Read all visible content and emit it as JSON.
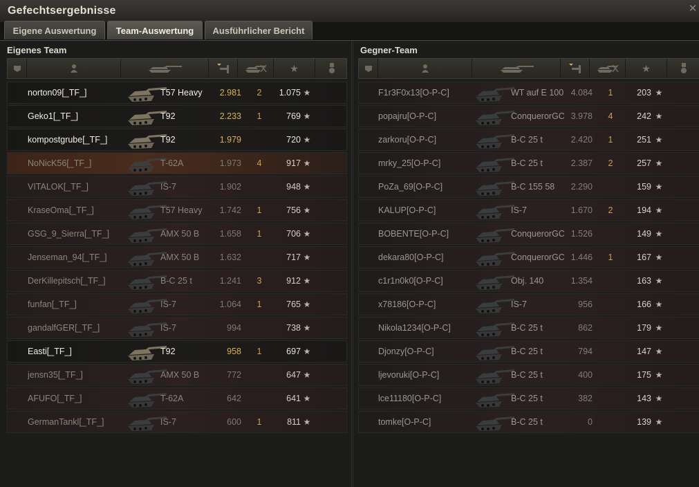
{
  "window": {
    "title": "Gefechtsergebnisse"
  },
  "tabs": [
    {
      "label": "Eigene Auswertung",
      "active": false
    },
    {
      "label": "Team-Auswertung",
      "active": true
    },
    {
      "label": "Ausführlicher Bericht",
      "active": false
    }
  ],
  "own_team": {
    "title": "Eigenes Team",
    "headers": [
      "squad-icon",
      "player-icon",
      "tank-icon",
      "experience-sort-icon",
      "kills-icon",
      "star-icon",
      "medal-icon"
    ],
    "players": [
      {
        "name": "norton09[_TF_]",
        "tank": "T57 Heavy",
        "xp": "2.981",
        "kills": "2",
        "score": "1.075"
      },
      {
        "name": "Geko1[_TF_]",
        "tank": "T92",
        "xp": "2.233",
        "kills": "1",
        "score": "769"
      },
      {
        "name": "kompostgrube[_TF_]",
        "tank": "T92",
        "xp": "1.979",
        "kills": "",
        "score": "720"
      },
      {
        "name": "NoNicK56[_TF_]",
        "tank": "T-62A",
        "xp": "1.973",
        "kills": "4",
        "score": "917"
      },
      {
        "name": "VITALOK[_TF_]",
        "tank": "IS-7",
        "xp": "1.902",
        "kills": "",
        "score": "948"
      },
      {
        "name": "KraseOma[_TF_]",
        "tank": "T57 Heavy",
        "xp": "1.742",
        "kills": "1",
        "score": "756"
      },
      {
        "name": "GSG_9_Sierra[_TF_]",
        "tank": "AMX 50 B",
        "xp": "1.658",
        "kills": "1",
        "score": "706"
      },
      {
        "name": "Jenseman_94[_TF_]",
        "tank": "AMX 50 B",
        "xp": "1.632",
        "kills": "",
        "score": "717"
      },
      {
        "name": "DerKillepitsch[_TF_]",
        "tank": "B-C 25 t",
        "xp": "1.241",
        "kills": "3",
        "score": "912"
      },
      {
        "name": "funfan[_TF_]",
        "tank": "IS-7",
        "xp": "1.064",
        "kills": "1",
        "score": "765"
      },
      {
        "name": "gandalfGER[_TF_]",
        "tank": "IS-7",
        "xp": "994",
        "kills": "",
        "score": "738"
      },
      {
        "name": "Easti[_TF_]",
        "tank": "T92",
        "xp": "958",
        "kills": "1",
        "score": "697"
      },
      {
        "name": "jensn35[_TF_]",
        "tank": "AMX 50 B",
        "xp": "772",
        "kills": "",
        "score": "647"
      },
      {
        "name": "AFUFO[_TF_]",
        "tank": "T-62A",
        "xp": "642",
        "kills": "",
        "score": "641"
      },
      {
        "name": "GermanTankl[_TF_]",
        "tank": "IS-7",
        "xp": "600",
        "kills": "1",
        "score": "811"
      }
    ]
  },
  "enemy_team": {
    "title": "Gegner-Team",
    "headers": [
      "squad-icon",
      "player-icon",
      "tank-icon",
      "experience-sort-icon",
      "kills-icon",
      "star-icon",
      "medal-icon"
    ],
    "players": [
      {
        "name": "F1r3F0x13[O-P-C]",
        "tank": "WT auf E 100",
        "xp": "4.084",
        "kills": "1",
        "score": "203"
      },
      {
        "name": "popajru[O-P-C]",
        "tank": "ConquerorGC",
        "xp": "3.978",
        "kills": "4",
        "score": "242"
      },
      {
        "name": "zarkoru[O-P-C]",
        "tank": "B-C 25 t",
        "xp": "2.420",
        "kills": "1",
        "score": "251"
      },
      {
        "name": "mrky_25[O-P-C]",
        "tank": "B-C 25 t",
        "xp": "2.387",
        "kills": "2",
        "score": "257"
      },
      {
        "name": "PoZa_69[O-P-C]",
        "tank": "B-C 155 58",
        "xp": "2.290",
        "kills": "",
        "score": "159"
      },
      {
        "name": "KALUP[O-P-C]",
        "tank": "IS-7",
        "xp": "1.670",
        "kills": "2",
        "score": "194"
      },
      {
        "name": "BOBENTE[O-P-C]",
        "tank": "ConquerorGC",
        "xp": "1.526",
        "kills": "",
        "score": "149"
      },
      {
        "name": "dekara80[O-P-C]",
        "tank": "ConquerorGC",
        "xp": "1.446",
        "kills": "1",
        "score": "167"
      },
      {
        "name": "c1r1n0k0[O-P-C]",
        "tank": "Obj. 140",
        "xp": "1.354",
        "kills": "",
        "score": "163"
      },
      {
        "name": "x78186[O-P-C]",
        "tank": "IS-7",
        "xp": "956",
        "kills": "",
        "score": "166"
      },
      {
        "name": "Nikola1234[O-P-C]",
        "tank": "B-C 25 t",
        "xp": "862",
        "kills": "",
        "score": "179"
      },
      {
        "name": "Djonzy[O-P-C]",
        "tank": "B-C 25 t",
        "xp": "794",
        "kills": "",
        "score": "147"
      },
      {
        "name": "ljevoruki[O-P-C]",
        "tank": "B-C 25 t",
        "xp": "400",
        "kills": "",
        "score": "175"
      },
      {
        "name": "lce11180[O-P-C]",
        "tank": "B-C 25 t",
        "xp": "382",
        "kills": "",
        "score": "143"
      },
      {
        "name": "tomke[O-P-C]",
        "tank": "B-C 25 t",
        "xp": "0",
        "kills": "",
        "score": "139"
      }
    ]
  },
  "colors": {
    "alive_text": "#f2eee4",
    "dead_text": "#8a8579",
    "xp_gold": "#d8b24e",
    "kills": "#c9a24a",
    "highlight_row": "#4a2c1c"
  }
}
